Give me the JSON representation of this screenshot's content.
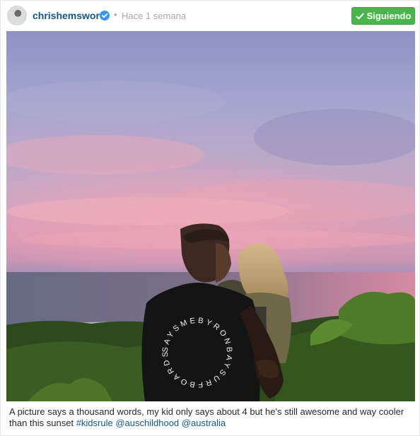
{
  "post": {
    "username": "chrishemsworth",
    "separator": "•",
    "timestamp": "Hace 1 semana",
    "follow_label": "Siguiendo",
    "caption_text": "A picture says a thousand words, my kid only says about 4 but he's still awesome and way cooler than this sunset",
    "tags": [
      "#kidsrule",
      "@auschildhood",
      "@australia"
    ],
    "shirt_print": "SAYSMEBYRONBAYSURFBOARDSBYRONB"
  },
  "icons": {
    "verified": "verified-badge-icon",
    "check": "check-icon"
  },
  "colors": {
    "username": "#125688",
    "follow_button": "#4ab44d",
    "muted_text": "#a5a7aa",
    "caption_text": "#262626"
  }
}
